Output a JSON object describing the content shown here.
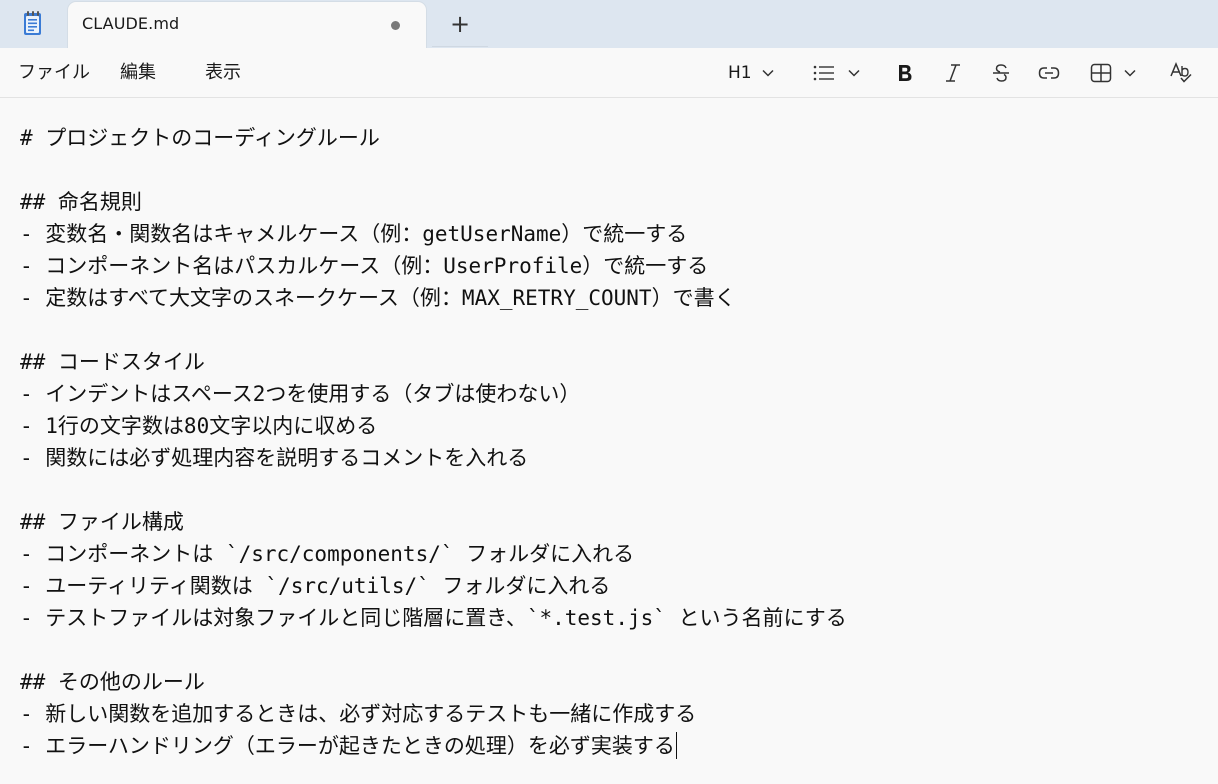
{
  "tabs": [
    {
      "title": "CLAUDE.md",
      "modified": true
    }
  ],
  "new_tab_label": "+",
  "menu": {
    "file": "ファイル",
    "edit": "編集",
    "view": "表示"
  },
  "toolbar": {
    "heading_label": "H1",
    "icons": [
      "heading-dropdown",
      "list-icon",
      "bold-icon",
      "italic-icon",
      "strikethrough-icon",
      "link-icon",
      "table-icon",
      "spellcheck-icon"
    ]
  },
  "document": {
    "lines": [
      "# プロジェクトのコーディングルール",
      "",
      "## 命名規則",
      "- 変数名・関数名はキャメルケース（例：getUserName）で統一する",
      "- コンポーネント名はパスカルケース（例：UserProfile）で統一する",
      "- 定数はすべて大文字のスネークケース（例：MAX_RETRY_COUNT）で書く",
      "",
      "## コードスタイル",
      "- インデントはスペース2つを使用する（タブは使わない）",
      "- 1行の文字数は80文字以内に収める",
      "- 関数には必ず処理内容を説明するコメントを入れる",
      "",
      "## ファイル構成",
      "- コンポーネントは `/src/components/` フォルダに入れる",
      "- ユーティリティ関数は `/src/utils/` フォルダに入れる",
      "- テストファイルは対象ファイルと同じ階層に置き、`*.test.js` という名前にする",
      "",
      "## その他のルール",
      "- 新しい関数を追加するときは、必ず対応するテストも一緒に作成する",
      "- エラーハンドリング（エラーが起きたときの処理）を必ず実装する"
    ]
  }
}
